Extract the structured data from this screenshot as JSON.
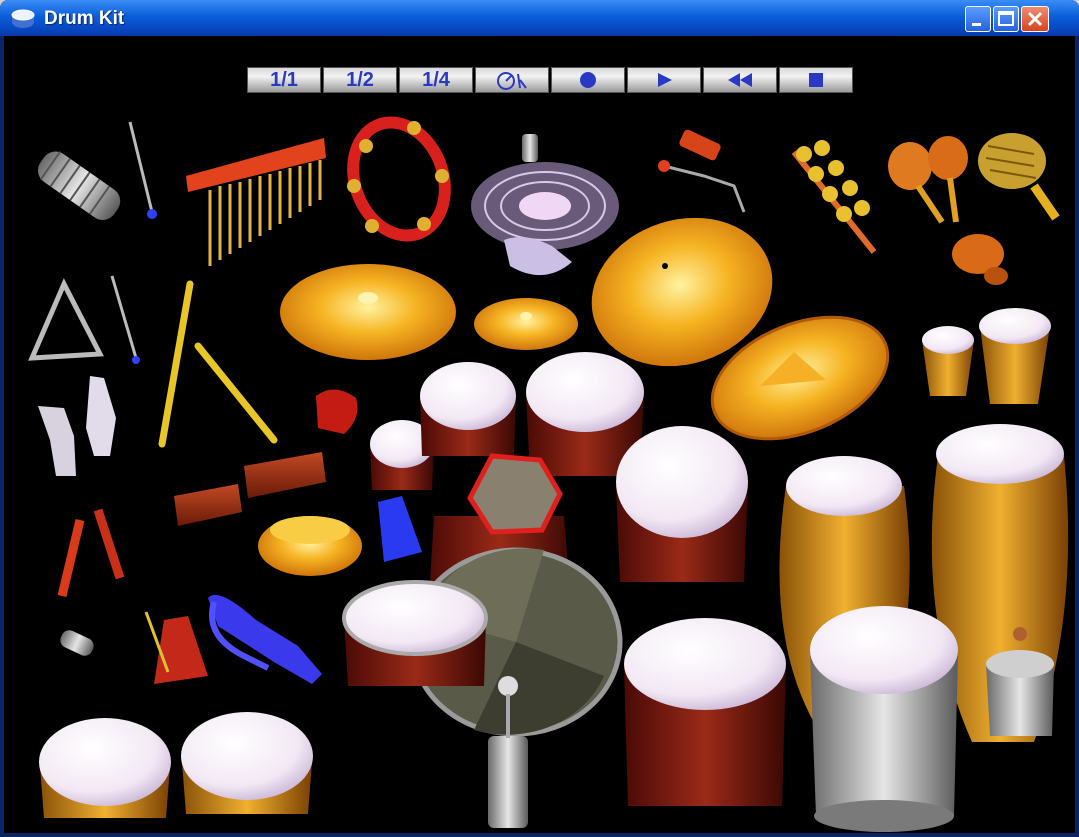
{
  "window": {
    "title": "Drum Kit",
    "icon": "drum-icon",
    "controls": [
      "minimize-icon",
      "maximize-icon",
      "close-icon"
    ]
  },
  "toolbar": {
    "buttons": [
      {
        "label": "1/1",
        "name": "whole-note-button"
      },
      {
        "label": "1/2",
        "name": "half-note-button"
      },
      {
        "label": "1/4",
        "name": "quarter-note-button"
      },
      {
        "label": "",
        "icon": "metronome-icon",
        "name": "tempo-button"
      },
      {
        "label": "",
        "icon": "record-icon",
        "name": "record-button"
      },
      {
        "label": "",
        "icon": "play-icon",
        "name": "play-button"
      },
      {
        "label": "",
        "icon": "rewind-icon",
        "name": "rewind-button"
      },
      {
        "label": "",
        "icon": "stop-icon",
        "name": "stop-button"
      }
    ]
  },
  "instruments": [
    "vibraslap",
    "mallet",
    "mark-tree-chimes",
    "tambourine",
    "scratch-turntable",
    "cowbell-stick",
    "jingle-bells",
    "maracas",
    "cabasa",
    "triangle",
    "drumsticks",
    "crash-cymbal",
    "splash-cymbal",
    "ride-cymbal",
    "china-cymbal",
    "bongos",
    "hand-clap",
    "castanet",
    "tom-small",
    "tom-mid",
    "tom-high",
    "tom-floor",
    "octoban-pad",
    "conga-low",
    "conga-high",
    "claves",
    "wood-blocks",
    "hi-hat",
    "cowbell",
    "whistle",
    "metronome",
    "agogo-bells",
    "snare-drum",
    "bass-drum",
    "floor-tom",
    "timbale",
    "shaker-can",
    "kick-pedal",
    "timbale-left",
    "timbale-right"
  ],
  "colors": {
    "background": "#000000",
    "titlebar": "#0a5fd8",
    "toolbar_text": "#2a39c4",
    "cymbal": "#f2b020",
    "drum_head": "#f4eef6",
    "shell": "#7a1a10"
  }
}
